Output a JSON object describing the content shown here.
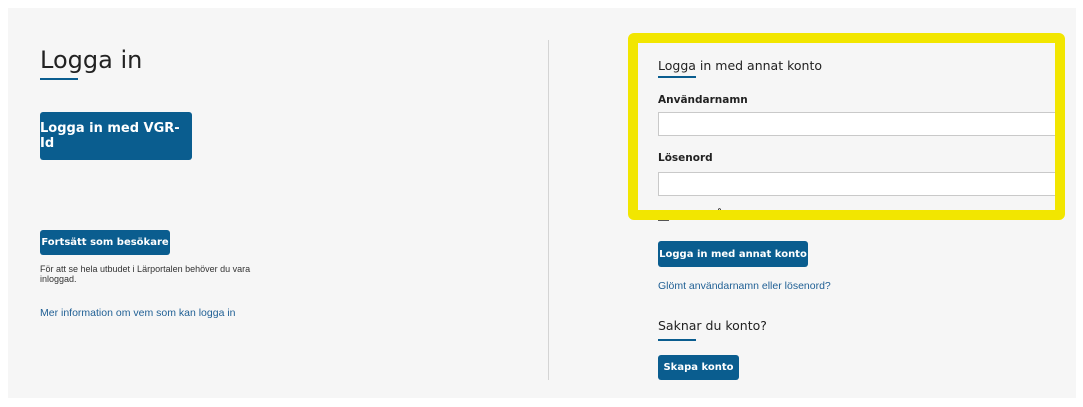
{
  "left": {
    "title": "Logga in",
    "vgr_button": "Logga in med VGR-Id",
    "guest_button": "Fortsätt som besökare",
    "guest_note": "För att se hela utbudet i Lärportalen behöver du vara inloggad.",
    "info_link": "Mer information om vem som kan logga in"
  },
  "right": {
    "title": "Logga in med annat konto",
    "username_label": "Användarnamn",
    "username_value": "",
    "password_label": "Lösenord",
    "password_value": "",
    "remember_label": "Kom ihåg användarnamn",
    "remember_checked": false,
    "submit_button": "Logga in med annat konto",
    "forgot_link": "Glömt användarnamn eller lösenord?",
    "no_account_title": "Saknar du konto?",
    "create_button": "Skapa konto"
  },
  "colors": {
    "primary": "#0a5d8f",
    "link": "#1f5f94",
    "highlight": "#f2e600",
    "panel": "#f6f6f6"
  }
}
